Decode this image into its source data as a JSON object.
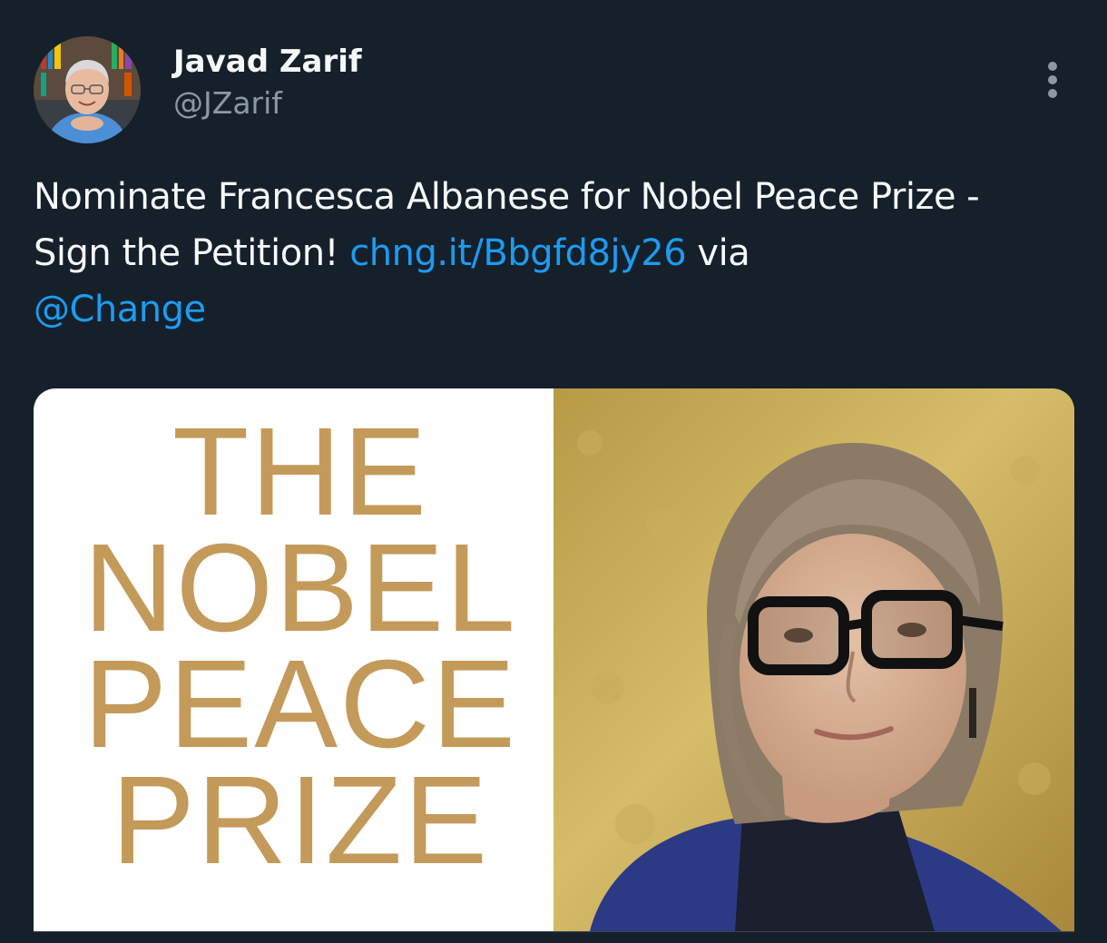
{
  "author": {
    "display_name": "Javad Zarif",
    "handle": "@JZarif"
  },
  "tweet": {
    "text_part1": "Nominate Francesca Albanese for Nobel Peace Prize - Sign the Petition! ",
    "link": "chng.it/Bbgfd8jy26",
    "text_part2": " via ",
    "mention": "@Change"
  },
  "media": {
    "prize_lines": [
      "THE",
      "NOBEL",
      "PEACE",
      "PRIZE"
    ]
  },
  "icons": {
    "more": "more-vertical-icon",
    "avatar": "profile-photo"
  },
  "colors": {
    "background": "#15202b",
    "text": "#f7f9f9",
    "secondary": "#8b98a5",
    "link": "#1d9bf0",
    "prize_gold": "#c49a5a"
  }
}
